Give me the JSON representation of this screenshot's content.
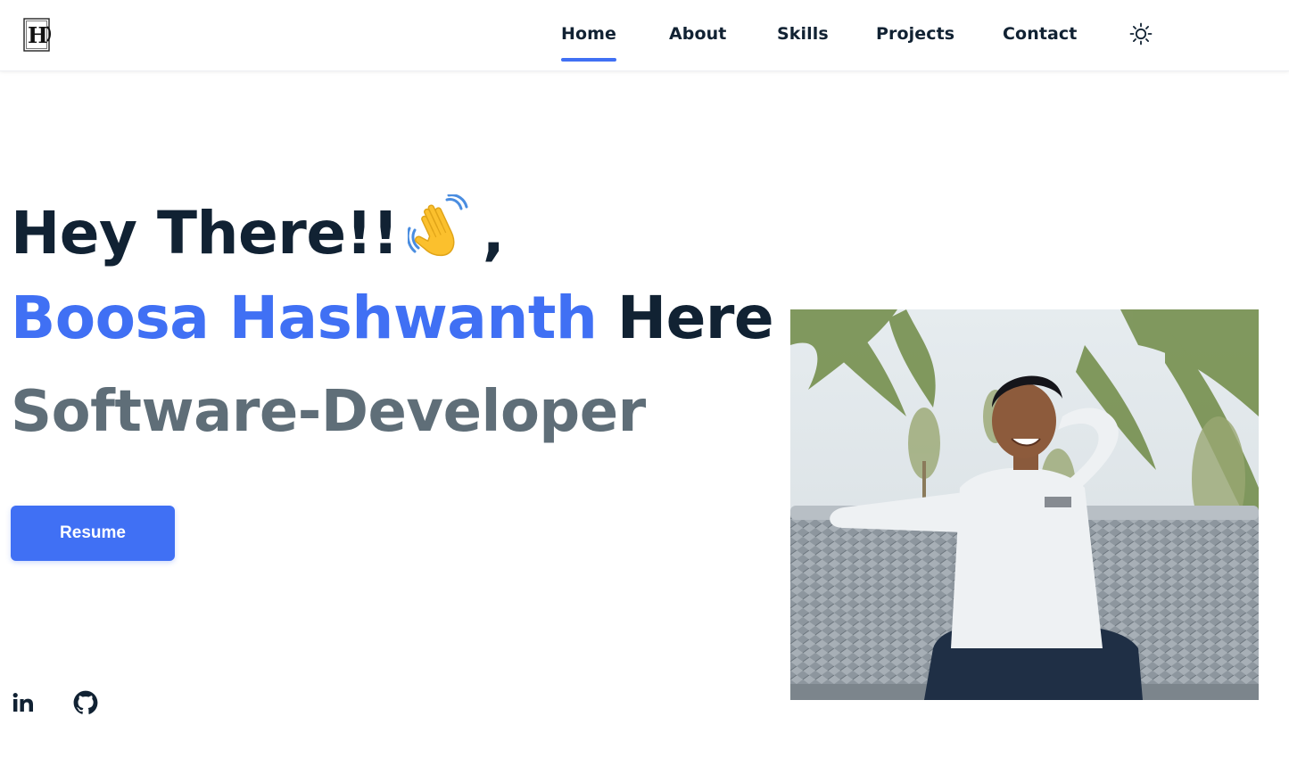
{
  "header": {
    "logo_text": "H",
    "nav": [
      {
        "label": "Home",
        "active": true
      },
      {
        "label": "About",
        "active": false
      },
      {
        "label": "Skills",
        "active": false
      },
      {
        "label": "Projects",
        "active": false
      },
      {
        "label": "Contact",
        "active": false
      }
    ],
    "theme_icon": "sun-icon"
  },
  "hero": {
    "greeting": "Hey There!!",
    "greeting_emoji": "waving-hand-icon",
    "greeting_suffix": ",",
    "name": "Boosa Hashwanth",
    "name_suffix": "Here",
    "role": "Software-Developer",
    "resume_label": "Resume"
  },
  "social": [
    {
      "name": "linkedin-icon"
    },
    {
      "name": "github-icon"
    }
  ],
  "photo": {
    "description_icon": "profile-photo"
  },
  "colors": {
    "accent": "#4070f4",
    "text_dark": "#112233",
    "text_muted": "#5f6e78",
    "background": "#ffffff"
  }
}
